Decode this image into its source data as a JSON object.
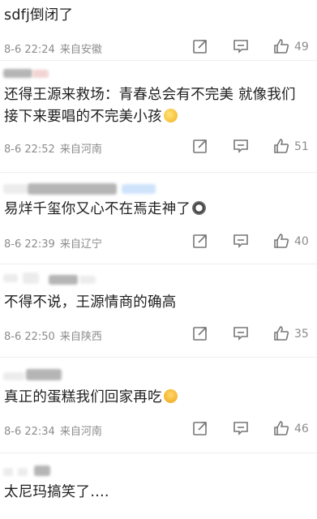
{
  "comments": [
    {
      "text": "sdfj倒闭了",
      "time": "8-6 22:24",
      "location": "来自安徽",
      "likes": "49"
    },
    {
      "text": "还得王源来救场：青春总会有不完美 就像我们接下来要唱的不完美小孩",
      "emoji": "hugging-face-emoji",
      "time": "8-6 22:52",
      "location": "来自河南",
      "likes": "51"
    },
    {
      "text": "易烊千玺你又心不在焉走神了",
      "emoji": "panda-emoji",
      "time": "8-6 22:39",
      "location": "来自辽宁",
      "likes": "40"
    },
    {
      "text": "不得不说，王源情商的确高",
      "time": "8-6 22:50",
      "location": "来自陕西",
      "likes": "35"
    },
    {
      "text": "真正的蛋糕我们回家再吃",
      "emoji": "crying-face-emoji",
      "time": "8-6 22:34",
      "location": "来自河南",
      "likes": "46"
    },
    {
      "text": "太尼玛搞笑了….",
      "time": "",
      "location": "",
      "likes": ""
    }
  ],
  "icons": {
    "forward": "forward-icon",
    "reply": "comment-icon",
    "like": "thumbs-up-icon"
  },
  "colors": {
    "meta_text": "#8c8c8c",
    "body_text": "#1f1f1f",
    "divider": "#eeeeee"
  }
}
